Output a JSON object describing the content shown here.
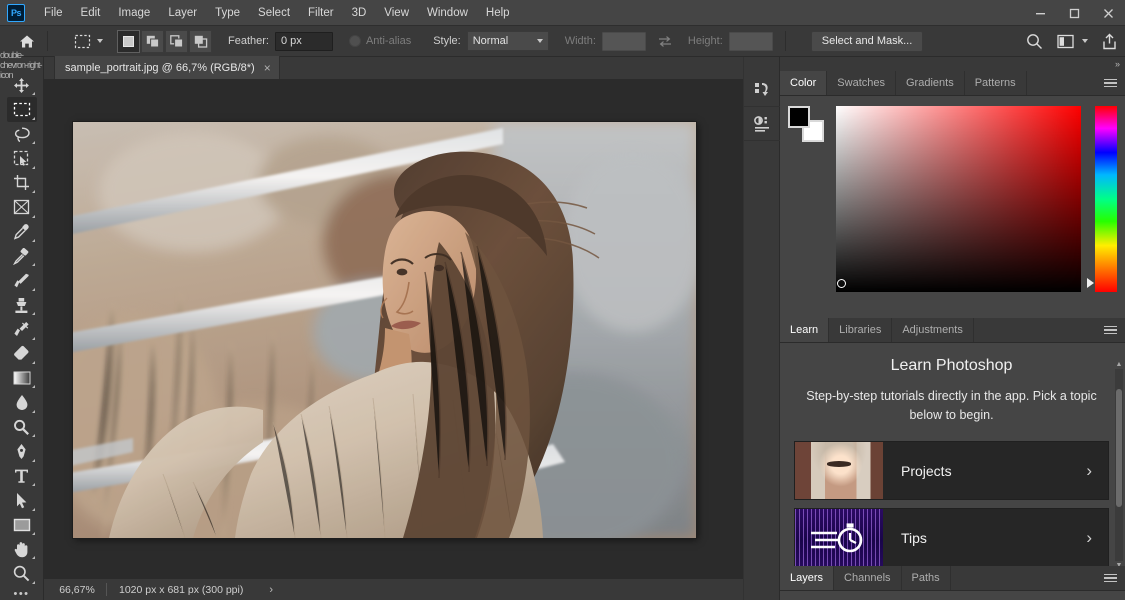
{
  "app": {
    "logo_text": "Ps",
    "menus": [
      "File",
      "Edit",
      "Image",
      "Layer",
      "Type",
      "Select",
      "Filter",
      "3D",
      "View",
      "Window",
      "Help"
    ],
    "window_controls": [
      "minimize",
      "maximize",
      "close"
    ]
  },
  "options_bar": {
    "home_icon": "home-icon",
    "tool_icon": "rectangular-marquee-icon",
    "selection_modes": [
      "new-selection",
      "add-to-selection",
      "subtract-from-selection",
      "intersect-with-selection"
    ],
    "active_selection_mode": "new-selection",
    "feather_label": "Feather:",
    "feather_value": "0 px",
    "antialias_label": "Anti-alias",
    "antialias_enabled": false,
    "style_label": "Style:",
    "style_value": "Normal",
    "width_label": "Width:",
    "width_value": "",
    "height_label": "Height:",
    "height_value": "",
    "swap_icon": "swap-width-height-icon",
    "select_and_mask_label": "Select and Mask...",
    "right_icons": [
      "search-icon",
      "workspace-icon",
      "share-icon"
    ]
  },
  "toolbar": {
    "expand_icon": "double-chevron-right-icon",
    "tools": [
      {
        "name": "move-tool",
        "icon": "move-icon",
        "active": false
      },
      {
        "name": "rectangular-marquee-tool",
        "icon": "marquee-icon",
        "active": true
      },
      {
        "name": "lasso-tool",
        "icon": "lasso-icon",
        "active": false
      },
      {
        "name": "object-selection-tool",
        "icon": "quick-selection-icon",
        "active": false
      },
      {
        "name": "crop-tool",
        "icon": "crop-icon",
        "active": false
      },
      {
        "name": "frame-tool",
        "icon": "frame-icon",
        "active": false
      },
      {
        "name": "eyedropper-tool",
        "icon": "eyedropper-icon",
        "active": false
      },
      {
        "name": "spot-healing-brush-tool",
        "icon": "healing-brush-icon",
        "active": false
      },
      {
        "name": "brush-tool",
        "icon": "brush-icon",
        "active": false
      },
      {
        "name": "clone-stamp-tool",
        "icon": "clone-stamp-icon",
        "active": false
      },
      {
        "name": "history-brush-tool",
        "icon": "history-brush-icon",
        "active": false
      },
      {
        "name": "eraser-tool",
        "icon": "eraser-icon",
        "active": false
      },
      {
        "name": "gradient-tool",
        "icon": "gradient-icon",
        "active": false
      },
      {
        "name": "blur-tool",
        "icon": "blur-drop-icon",
        "active": false
      },
      {
        "name": "dodge-tool",
        "icon": "dodge-icon",
        "active": false
      },
      {
        "name": "pen-tool",
        "icon": "pen-icon",
        "active": false
      },
      {
        "name": "type-tool",
        "icon": "type-t-icon",
        "active": false
      },
      {
        "name": "path-selection-tool",
        "icon": "path-arrow-icon",
        "active": false
      },
      {
        "name": "rectangle-tool",
        "icon": "rectangle-icon",
        "active": false
      },
      {
        "name": "hand-tool",
        "icon": "hand-icon",
        "active": false
      },
      {
        "name": "zoom-tool",
        "icon": "magnifier-icon",
        "active": false
      }
    ],
    "more_tools_label": "•••"
  },
  "document": {
    "tab_title": "sample_portrait.jpg @ 66,7% (RGB/8*)",
    "close_label": "×"
  },
  "status_bar": {
    "zoom": "66,67%",
    "dimensions": "1020 px x 681 px (300 ppi)",
    "arrow": "›"
  },
  "rail": {
    "collapse_left": "«",
    "collapse_right": "»",
    "buttons": [
      "history-panel-icon",
      "adjustments-panel-icon"
    ]
  },
  "color_panel": {
    "tabs": [
      "Color",
      "Swatches",
      "Gradients",
      "Patterns"
    ],
    "active_tab": "Color",
    "menu_icon": "panel-menu-icon",
    "foreground_color": "#000000",
    "background_color": "#ffffff",
    "picker_icon": "color-field",
    "hue_icon": "hue-strip"
  },
  "learn_panel": {
    "tabs": [
      "Learn",
      "Libraries",
      "Adjustments"
    ],
    "active_tab": "Learn",
    "menu_icon": "panel-menu-icon",
    "title": "Learn Photoshop",
    "subtitle": "Step-by-step tutorials directly in the app. Pick a topic below to begin.",
    "cards": [
      {
        "label": "Projects",
        "thumb": "portrait-thumbnail",
        "chevron": "›"
      },
      {
        "label": "Tips",
        "thumb": "stopwatch-thumbnail",
        "chevron": "›"
      }
    ]
  },
  "layers_panel": {
    "tabs": [
      "Layers",
      "Channels",
      "Paths"
    ],
    "active_tab": "Layers",
    "menu_icon": "panel-menu-icon"
  },
  "colors": {
    "chrome": "#393939",
    "titlebar": "#454545",
    "canvas": "#2b2b2b",
    "accent": "#31a8ff",
    "text": "#d4d4d4"
  }
}
